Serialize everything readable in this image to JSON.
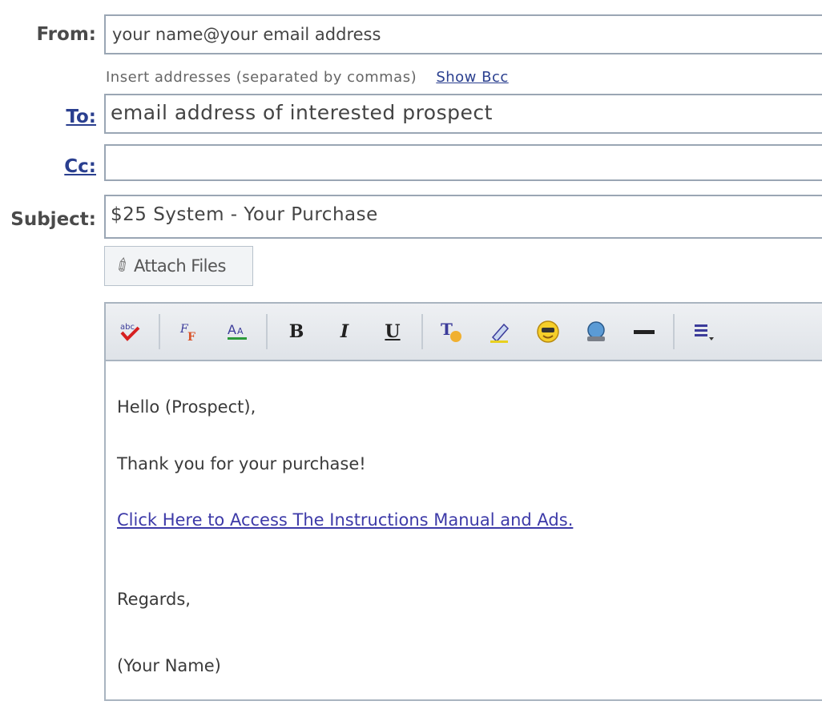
{
  "labels": {
    "from": "From:",
    "to": "To:",
    "cc": "Cc:",
    "subject": "Subject:"
  },
  "fields": {
    "from_value": "your name@your email address",
    "to_value": "email address of interested prospect",
    "cc_value": "",
    "subject_value": "$25 System - Your Purchase"
  },
  "hint": {
    "text": "Insert addresses (separated by commas)",
    "show_bcc": "Show Bcc"
  },
  "attach": {
    "label": "Attach Files",
    "icon": "paperclip-icon"
  },
  "toolbar": {
    "icons": [
      "spellcheck-icon",
      "font-icon",
      "font-size-icon",
      "bold-icon",
      "italic-icon",
      "underline-icon",
      "text-color-icon",
      "highlight-icon",
      "emoticon-icon",
      "insert-image-icon",
      "horizontal-rule-icon",
      "align-icon"
    ],
    "bold": "B",
    "italic": "I",
    "underline": "U"
  },
  "message": {
    "greeting": "Hello (Prospect),",
    "thanks": "Thank you for your purchase!",
    "link": "Click Here to Access The Instructions Manual and Ads.",
    "regards": "Regards,",
    "signature": "(Your Name)"
  }
}
